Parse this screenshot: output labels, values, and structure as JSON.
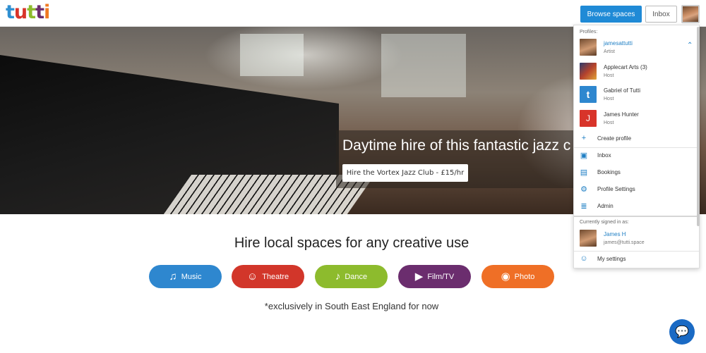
{
  "header": {
    "logo_letters": [
      {
        "char": "t",
        "color": "#2f8fd1"
      },
      {
        "char": "u",
        "color": "#d8342a"
      },
      {
        "char": "t",
        "color": "#8dbb2d"
      },
      {
        "char": "t",
        "color": "#6b2d6e"
      },
      {
        "char": "i",
        "color": "#f07a22"
      }
    ],
    "browse_label": "Browse spaces",
    "inbox_label": "Inbox"
  },
  "hero": {
    "caption_title": "Daytime hire of this fantastic jazz c",
    "caption_button": "Hire the Vortex Jazz Club - £15/hr"
  },
  "main": {
    "headline": "Hire local spaces for any creative use",
    "categories": [
      {
        "label": "Music",
        "icon": "music-icon",
        "glyph": "♫",
        "color": "#2e87cf"
      },
      {
        "label": "Theatre",
        "icon": "theatre-masks-icon",
        "glyph": "☺",
        "color": "#d2362a"
      },
      {
        "label": "Dance",
        "icon": "dance-icon",
        "glyph": "♪",
        "color": "#8dbb2d"
      },
      {
        "label": "Film/TV",
        "icon": "film-icon",
        "glyph": "▶",
        "color": "#6b2d6e"
      },
      {
        "label": "Photo",
        "icon": "camera-icon",
        "glyph": "◉",
        "color": "#ef6f26"
      }
    ],
    "note": "*exclusively in South East England for now"
  },
  "dropdown": {
    "profiles_label": "Profiles:",
    "profiles": [
      {
        "name": "jamesattutti",
        "role": "Artist",
        "active": true,
        "avatar_color": "#b07a52"
      },
      {
        "name": "Applecart Arts (3)",
        "role": "Host",
        "active": false,
        "avatar_color": "#8a3b2e"
      },
      {
        "name": "Gabriel of Tutti",
        "role": "Host",
        "active": false,
        "avatar_color": "#2e87cf"
      },
      {
        "name": "James Hunter",
        "role": "Host",
        "active": false,
        "avatar_color": "#d8342a"
      }
    ],
    "create_profile": "Create profile",
    "menu": [
      {
        "label": "Inbox",
        "icon": "inbox-icon"
      },
      {
        "label": "Bookings",
        "icon": "calendar-icon"
      },
      {
        "label": "Profile Settings",
        "icon": "gear-icon"
      },
      {
        "label": "Admin",
        "icon": "database-icon"
      }
    ],
    "signed_in_label": "Currently signed in as:",
    "user_name": "James H",
    "user_email": "james@tutti.space",
    "my_settings": "My settings"
  }
}
